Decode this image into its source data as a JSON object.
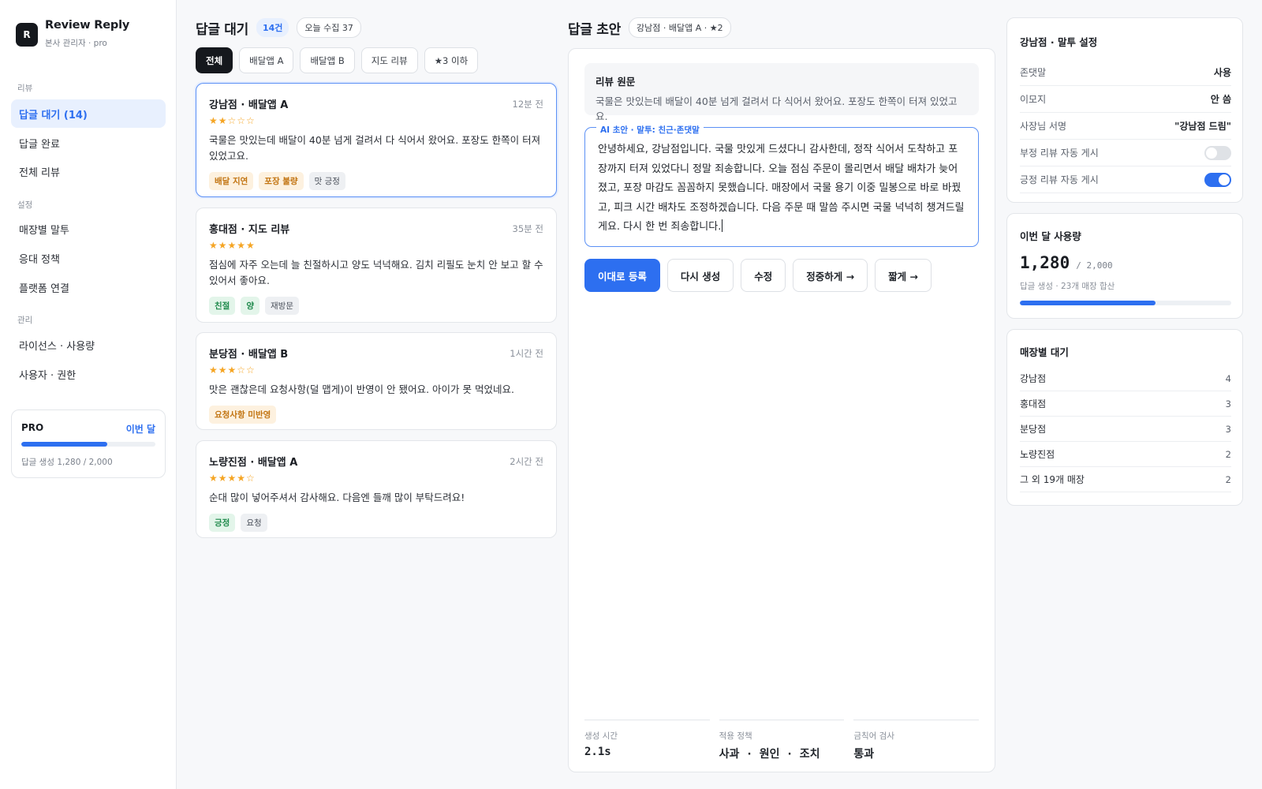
{
  "brand": {
    "logo": "R",
    "title": "Review Reply",
    "subtitle": "본사 관리자 · pro"
  },
  "sidebar": {
    "sections": [
      "리뷰",
      "설정",
      "관리"
    ],
    "items": [
      {
        "label": "답글 대기 (14)",
        "active": true
      },
      {
        "label": "답글 완료"
      },
      {
        "label": "전체 리뷰"
      },
      {
        "label": "매장별 말투"
      },
      {
        "label": "응대 정책"
      },
      {
        "label": "플랫폼 연결"
      },
      {
        "label": "라이선스 · 사용량"
      },
      {
        "label": "사용자 · 권한"
      }
    ],
    "plan": {
      "label": "PRO",
      "period": "이번 달",
      "usage_text": "답글 생성 1,280 / 2,000",
      "fraction": 0.64
    }
  },
  "queue": {
    "title": "답글 대기",
    "count": "14건",
    "today": "오늘 수집 37",
    "filters": [
      "전체",
      "배달앱 A",
      "배달앱 B",
      "지도 리뷰",
      "★3 이하"
    ],
    "reviews": [
      {
        "store": "강남점 · 배달앱 A",
        "time": "12분 전",
        "stars": "★★☆☆☆",
        "text": "국물은 맛있는데 배달이 40분 넘게 걸려서 다 식어서 왔어요. 포장도 한쪽이 터져 있었고요.",
        "tags": [
          "배달 지연",
          "포장 불량",
          "맛 긍정"
        ]
      },
      {
        "store": "홍대점 · 지도 리뷰",
        "time": "35분 전",
        "stars": "★★★★★",
        "text": "점심에 자주 오는데 늘 친절하시고 양도 넉넉해요. 김치 리필도 눈치 안 보고 할 수 있어서 좋아요.",
        "tags": [
          "친절",
          "양",
          "재방문"
        ]
      },
      {
        "store": "분당점 · 배달앱 B",
        "time": "1시간 전",
        "stars": "★★★☆☆",
        "text": "맛은 괜찮은데 요청사항(덜 맵게)이 반영이 안 됐어요. 아이가 못 먹었네요.",
        "tags": [
          "요청사항 미반영"
        ]
      },
      {
        "store": "노량진점 · 배달앱 A",
        "time": "2시간 전",
        "stars": "★★★★☆",
        "text": "순대 많이 넣어주셔서 감사해요. 다음엔 들깨 많이 부탁드려요!",
        "tags": [
          "긍정",
          "요청"
        ]
      }
    ]
  },
  "draft": {
    "title": "답글 초안",
    "context": "강남점 · 배달앱 A · ★2",
    "original_title": "리뷰 원문",
    "original_text": "국물은 맛있는데 배달이 40분 넘게 걸려서 다 식어서 왔어요. 포장도 한쪽이 터져 있었고요.",
    "ai_label": "AI 초안 · 말투: 친근·존댓말",
    "reply": "안녕하세요, 강남점입니다. 국물 맛있게 드셨다니 감사한데, 정작 식어서 도착하고 포장까지 터져 있었다니 정말 죄송합니다. 오늘 점심 주문이 몰리면서 배달 배차가 늦어졌고, 포장 마감도 꼼꼼하지 못했습니다. 매장에서 국물 용기 이중 밀봉으로 바로 바꿨고, 피크 시간 배차도 조정하겠습니다. 다음 주문 때 말씀 주시면 국물 넉넉히 챙겨드릴게요. 다시 한 번 죄송합니다.",
    "buttons": [
      "이대로 등록",
      "다시 생성",
      "수정",
      "정중하게 →",
      "짧게 →"
    ],
    "stats": [
      {
        "label": "생성 시간",
        "value": "2.1s"
      },
      {
        "label": "적용 정책",
        "value": "사과 · 원인 · 조치"
      },
      {
        "label": "금칙어 검사",
        "value": "통과"
      }
    ]
  },
  "settings": {
    "title": "강남점 · 말투 설정",
    "rows": [
      {
        "key": "존댓말",
        "value": "사용"
      },
      {
        "key": "이모지",
        "value": "안 씀"
      },
      {
        "key": "사장님 서명",
        "value": "\"강남점 드림\""
      },
      {
        "key": "부정 리뷰 자동 게시",
        "toggle": false
      },
      {
        "key": "긍정 리뷰 자동 게시",
        "toggle": true
      }
    ]
  },
  "usage": {
    "title": "이번 달 사용량",
    "used": "1,280",
    "total": "/ 2,000",
    "sub": "답글 생성 · 23개 매장 합산",
    "fraction": 0.64
  },
  "stores": {
    "title": "매장별 대기",
    "rows": [
      {
        "name": "강남점",
        "count": "4"
      },
      {
        "name": "홍대점",
        "count": "3"
      },
      {
        "name": "분당점",
        "count": "3"
      },
      {
        "name": "노량진점",
        "count": "2"
      },
      {
        "name": "그 외 19개 매장",
        "count": "2"
      }
    ]
  },
  "colors": {
    "accent": "#2d6ff0",
    "star": "#f5a524",
    "dark": "#15181d"
  }
}
